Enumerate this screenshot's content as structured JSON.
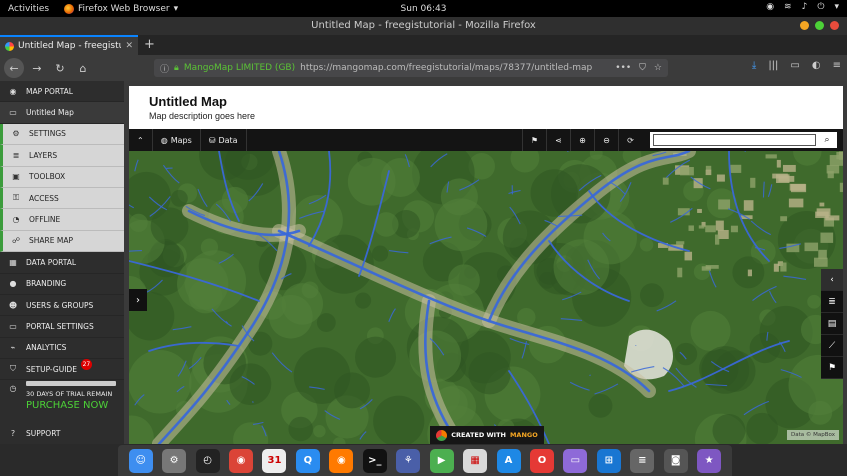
{
  "topbar": {
    "activities": "Activities",
    "app_name": "Firefox Web Browser",
    "app_caret": "▾",
    "clock": "Sun 06:43",
    "tray": [
      "◉",
      "≋",
      "♪",
      "⏻",
      "▾"
    ]
  },
  "window": {
    "title": "Untitled Map - freegistutorial - Mozilla Firefox"
  },
  "tab": {
    "title": "Untitled Map - freegistut",
    "close": "✕",
    "new_tab": "+"
  },
  "navbar": {
    "back": "←",
    "forward": "→",
    "reload": "↻",
    "home": "⌂",
    "identity": "MangoMap LIMITED (GB)",
    "url": "https://mangomap.com/freegistutorial/maps/78377/untitled-map",
    "url_actions": [
      "•••",
      "⛉",
      "☆"
    ],
    "right_icons": [
      "⤓",
      "|||",
      "▭",
      "◐",
      "≡"
    ]
  },
  "sidebar": {
    "items": [
      {
        "label": "MAP PORTAL",
        "icon": "◉",
        "style": "top"
      },
      {
        "label": "Untitled Map",
        "icon": "▭",
        "style": "active"
      },
      {
        "label": "SETTINGS",
        "icon": "⚙",
        "style": "sub"
      },
      {
        "label": "LAYERS",
        "icon": "≣",
        "style": "sub"
      },
      {
        "label": "TOOLBOX",
        "icon": "▣",
        "style": "sub"
      },
      {
        "label": "ACCESS",
        "icon": "⚿",
        "style": "sub"
      },
      {
        "label": "OFFLINE",
        "icon": "◔",
        "style": "sub"
      },
      {
        "label": "SHARE MAP",
        "icon": "☍",
        "style": "sub"
      },
      {
        "label": "DATA PORTAL",
        "icon": "▦",
        "style": "top"
      },
      {
        "label": "BRANDING",
        "icon": "●",
        "style": "top"
      },
      {
        "label": "USERS & GROUPS",
        "icon": "☻",
        "style": "top"
      },
      {
        "label": "PORTAL SETTINGS",
        "icon": "▭",
        "style": "top"
      },
      {
        "label": "ANALYTICS",
        "icon": "⌁",
        "style": "top"
      },
      {
        "label": "SETUP-GUIDE",
        "icon": "⛉",
        "style": "top",
        "badge": "27"
      }
    ],
    "trial_text": "30 DAYS OF TRIAL REMAIN",
    "purchase": "PURCHASE NOW",
    "support": "SUPPORT",
    "support_icon": "?",
    "clock_icon": "◷"
  },
  "map_header": {
    "title": "Untitled Map",
    "description": "Map description goes here"
  },
  "map_toolbar": {
    "collapse": "⌃",
    "maps_label": "Maps",
    "maps_icon": "◍",
    "data_label": "Data",
    "data_icon": "⛁",
    "tools": [
      "⚑",
      "⋖",
      "⊕",
      "⊖",
      "⟳"
    ],
    "search_button": "⌕",
    "search_value": ""
  },
  "map": {
    "expand": "›",
    "controls": [
      "‹",
      "≣",
      "▤",
      "⟋",
      "⚑"
    ],
    "attribution": "Data © MapBox",
    "created_with": "CREATED WITH",
    "brand": "MANGO",
    "colors": {
      "forest": "#3f6a2c",
      "river": "#3a68d8",
      "urban": "#c9bfa0"
    }
  },
  "dock": {
    "icons": [
      {
        "name": "finder",
        "glyph": "☺",
        "color": "#3e8ef0"
      },
      {
        "name": "system-prefs",
        "glyph": "⚙",
        "color": "#777"
      },
      {
        "name": "clock",
        "glyph": "◴",
        "color": "#222"
      },
      {
        "name": "chrome",
        "glyph": "◉",
        "color": "#db4437"
      },
      {
        "name": "calendar",
        "glyph": "31",
        "color": "#eee"
      },
      {
        "name": "quicktime",
        "glyph": "Q",
        "color": "#2a8cf0"
      },
      {
        "name": "firefox",
        "glyph": "◉",
        "color": "#ff7a00"
      },
      {
        "name": "terminal",
        "glyph": ">_",
        "color": "#111"
      },
      {
        "name": "launchpad",
        "glyph": "⚘",
        "color": "#4a5fa8"
      },
      {
        "name": "ibooks",
        "glyph": "▶",
        "color": "#4caf50"
      },
      {
        "name": "preview",
        "glyph": "▦",
        "color": "#d9d9d9"
      },
      {
        "name": "app-store",
        "glyph": "A",
        "color": "#1e88e5"
      },
      {
        "name": "opera",
        "glyph": "O",
        "color": "#e53935"
      },
      {
        "name": "screen-share",
        "glyph": "▭",
        "color": "#8e6ad8"
      },
      {
        "name": "windows",
        "glyph": "⊞",
        "color": "#1976d2"
      },
      {
        "name": "stack",
        "glyph": "≡",
        "color": "#666"
      },
      {
        "name": "photo-booth",
        "glyph": "◙",
        "color": "#555"
      },
      {
        "name": "imovie",
        "glyph": "★",
        "color": "#7e57c2"
      }
    ]
  }
}
